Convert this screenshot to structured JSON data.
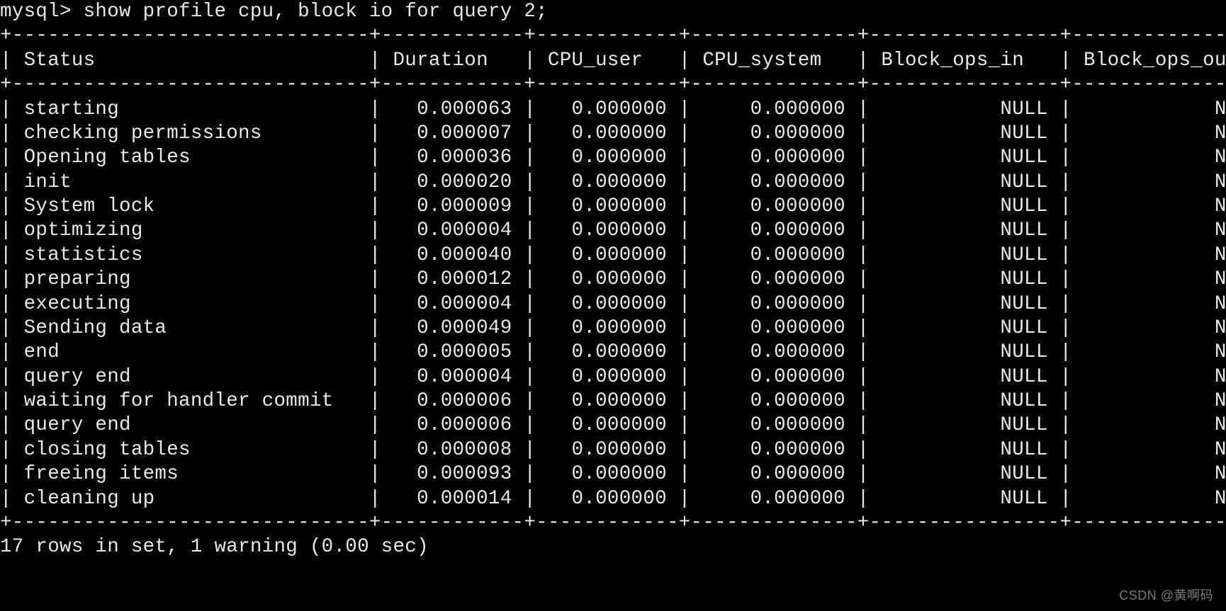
{
  "prompt": "mysql> ",
  "command": "show profile cpu, block io for query 2;",
  "columns": [
    "Status",
    "Duration",
    "CPU_user",
    "CPU_system",
    "Block_ops_in",
    "Block_ops_out"
  ],
  "rows": [
    {
      "status": "starting",
      "duration": "0.000063",
      "cpu_user": "0.000000",
      "cpu_system": "0.000000",
      "block_ops_in": "NULL",
      "block_ops_out": "NULL"
    },
    {
      "status": "checking permissions",
      "duration": "0.000007",
      "cpu_user": "0.000000",
      "cpu_system": "0.000000",
      "block_ops_in": "NULL",
      "block_ops_out": "NULL"
    },
    {
      "status": "Opening tables",
      "duration": "0.000036",
      "cpu_user": "0.000000",
      "cpu_system": "0.000000",
      "block_ops_in": "NULL",
      "block_ops_out": "NULL"
    },
    {
      "status": "init",
      "duration": "0.000020",
      "cpu_user": "0.000000",
      "cpu_system": "0.000000",
      "block_ops_in": "NULL",
      "block_ops_out": "NULL"
    },
    {
      "status": "System lock",
      "duration": "0.000009",
      "cpu_user": "0.000000",
      "cpu_system": "0.000000",
      "block_ops_in": "NULL",
      "block_ops_out": "NULL"
    },
    {
      "status": "optimizing",
      "duration": "0.000004",
      "cpu_user": "0.000000",
      "cpu_system": "0.000000",
      "block_ops_in": "NULL",
      "block_ops_out": "NULL"
    },
    {
      "status": "statistics",
      "duration": "0.000040",
      "cpu_user": "0.000000",
      "cpu_system": "0.000000",
      "block_ops_in": "NULL",
      "block_ops_out": "NULL"
    },
    {
      "status": "preparing",
      "duration": "0.000012",
      "cpu_user": "0.000000",
      "cpu_system": "0.000000",
      "block_ops_in": "NULL",
      "block_ops_out": "NULL"
    },
    {
      "status": "executing",
      "duration": "0.000004",
      "cpu_user": "0.000000",
      "cpu_system": "0.000000",
      "block_ops_in": "NULL",
      "block_ops_out": "NULL"
    },
    {
      "status": "Sending data",
      "duration": "0.000049",
      "cpu_user": "0.000000",
      "cpu_system": "0.000000",
      "block_ops_in": "NULL",
      "block_ops_out": "NULL"
    },
    {
      "status": "end",
      "duration": "0.000005",
      "cpu_user": "0.000000",
      "cpu_system": "0.000000",
      "block_ops_in": "NULL",
      "block_ops_out": "NULL"
    },
    {
      "status": "query end",
      "duration": "0.000004",
      "cpu_user": "0.000000",
      "cpu_system": "0.000000",
      "block_ops_in": "NULL",
      "block_ops_out": "NULL"
    },
    {
      "status": "waiting for handler commit",
      "duration": "0.000006",
      "cpu_user": "0.000000",
      "cpu_system": "0.000000",
      "block_ops_in": "NULL",
      "block_ops_out": "NULL"
    },
    {
      "status": "query end",
      "duration": "0.000006",
      "cpu_user": "0.000000",
      "cpu_system": "0.000000",
      "block_ops_in": "NULL",
      "block_ops_out": "NULL"
    },
    {
      "status": "closing tables",
      "duration": "0.000008",
      "cpu_user": "0.000000",
      "cpu_system": "0.000000",
      "block_ops_in": "NULL",
      "block_ops_out": "NULL"
    },
    {
      "status": "freeing items",
      "duration": "0.000093",
      "cpu_user": "0.000000",
      "cpu_system": "0.000000",
      "block_ops_in": "NULL",
      "block_ops_out": "NULL"
    },
    {
      "status": "cleaning up",
      "duration": "0.000014",
      "cpu_user": "0.000000",
      "cpu_system": "0.000000",
      "block_ops_in": "NULL",
      "block_ops_out": "NULL"
    }
  ],
  "summary": "17 rows in set, 1 warning (0.00 sec)",
  "watermark": "CSDN @黄啊码",
  "widths": {
    "status": 28,
    "duration": 10,
    "cpu_user": 10,
    "cpu_system": 12,
    "block_ops_in": 14,
    "block_ops_out": 15
  }
}
